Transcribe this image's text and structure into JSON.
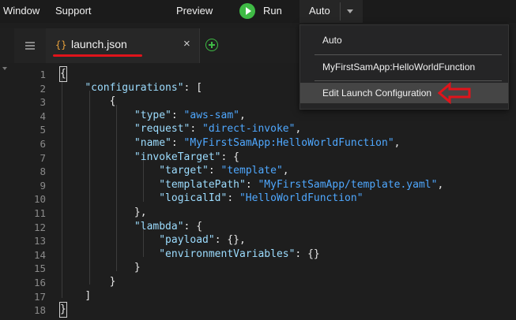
{
  "menubar": {
    "window": "Window",
    "support": "Support",
    "preview": "Preview",
    "run": "Run",
    "config_selected": "Auto"
  },
  "tab": {
    "icon": "{}",
    "title": "launch.json",
    "close": "×"
  },
  "dropdown": {
    "items": [
      "Auto",
      "MyFirstSamApp:HelloWorldFunction",
      "Edit Launch Configuration"
    ],
    "active_index": 2
  },
  "annotations": {
    "highlight_color": "#e0141b"
  },
  "editor": {
    "line_numbers": [
      "1",
      "2",
      "3",
      "4",
      "5",
      "6",
      "7",
      "8",
      "9",
      "10",
      "11",
      "12",
      "13",
      "14",
      "15",
      "16",
      "17",
      "18"
    ],
    "lines": {
      "l1": "{",
      "l2_key": "\"configurations\"",
      "l2_rest": ": [",
      "l3": "{",
      "l4_key": "\"type\"",
      "l4_val": "\"aws-sam\"",
      "l5_key": "\"request\"",
      "l5_val": "\"direct-invoke\"",
      "l6_key": "\"name\"",
      "l6_val": "\"MyFirstSamApp:HelloWorldFunction\"",
      "l7_key": "\"invokeTarget\"",
      "l7_rest": ": {",
      "l8_key": "\"target\"",
      "l8_val": "\"template\"",
      "l9_key": "\"templatePath\"",
      "l9_val": "\"MyFirstSamApp/template.yaml\"",
      "l10_key": "\"logicalId\"",
      "l10_val": "\"HelloWorldFunction\"",
      "l11": "},",
      "l12_key": "\"lambda\"",
      "l12_rest": ": {",
      "l13_key": "\"payload\"",
      "l13_rest": ": {},",
      "l14_key": "\"environmentVariables\"",
      "l14_rest": ": {}",
      "l15": "}",
      "l16": "}",
      "l17": "]",
      "l18": "}"
    }
  }
}
